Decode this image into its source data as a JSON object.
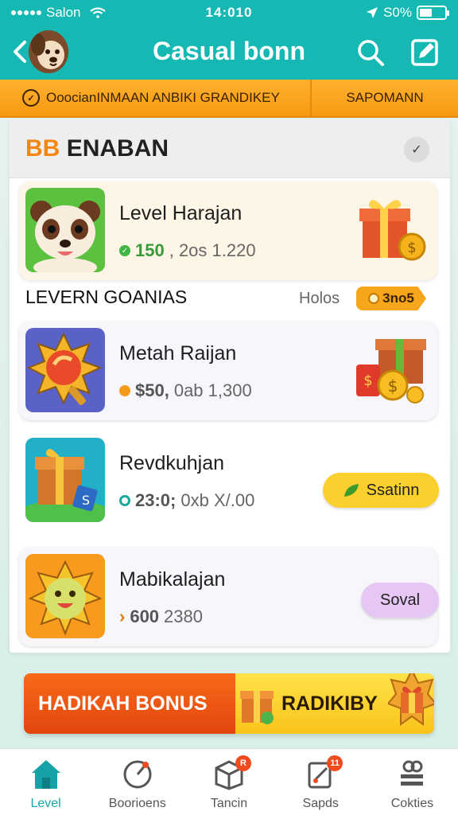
{
  "status_bar": {
    "carrier": "Salon",
    "time": "14:010",
    "battery": "S0%",
    "battery_level": 0.5
  },
  "header": {
    "title": "Casual bonn"
  },
  "banner": {
    "left_text": "OoocianINMAAN  ANBIKI  GRANDIKEY",
    "right_text": "SAPOMANN"
  },
  "section": {
    "title_prefix": "BB",
    "title": "ENABAN",
    "menu_glyph": "✓"
  },
  "items": [
    {
      "title": "Level Harajan",
      "lead": "150",
      "rest": ", 2os  1.220"
    },
    {
      "title": "Metah Raijan",
      "lead": "$50,",
      "rest": " 0ab  1,300"
    },
    {
      "title": "Revdkuhjan",
      "lead": "23:0;",
      "rest": " 0xb  X/.00",
      "button": "Ssatinn"
    },
    {
      "title": "Mabikalajan",
      "lead": "600",
      "rest": "  2380",
      "button": "Soval"
    }
  ],
  "row": {
    "label": "LEVERN GOANIAS",
    "hint": "Holos",
    "badge": "3no5"
  },
  "bonus": {
    "left": "HADIKAH BONUS",
    "right": "RADIKIBY"
  },
  "nav": [
    {
      "label": "Level",
      "active": true
    },
    {
      "label": "Boorioens",
      "badge": ""
    },
    {
      "label": "Tancin",
      "badge": "R"
    },
    {
      "label": "Sapds",
      "badge": "11"
    },
    {
      "label": "Cokties",
      "badge": ""
    }
  ],
  "colors": {
    "teal": "#15b8b2",
    "orange": "#f79a12",
    "bonus_red": "#e2460e",
    "bonus_yellow": "#f9c41a"
  },
  "icons": [
    "back-arrow-icon",
    "search-icon",
    "edit-icon",
    "coin-icon",
    "gift-box-icon",
    "home-icon",
    "compass-icon",
    "box-icon",
    "document-icon",
    "stack-icon"
  ]
}
